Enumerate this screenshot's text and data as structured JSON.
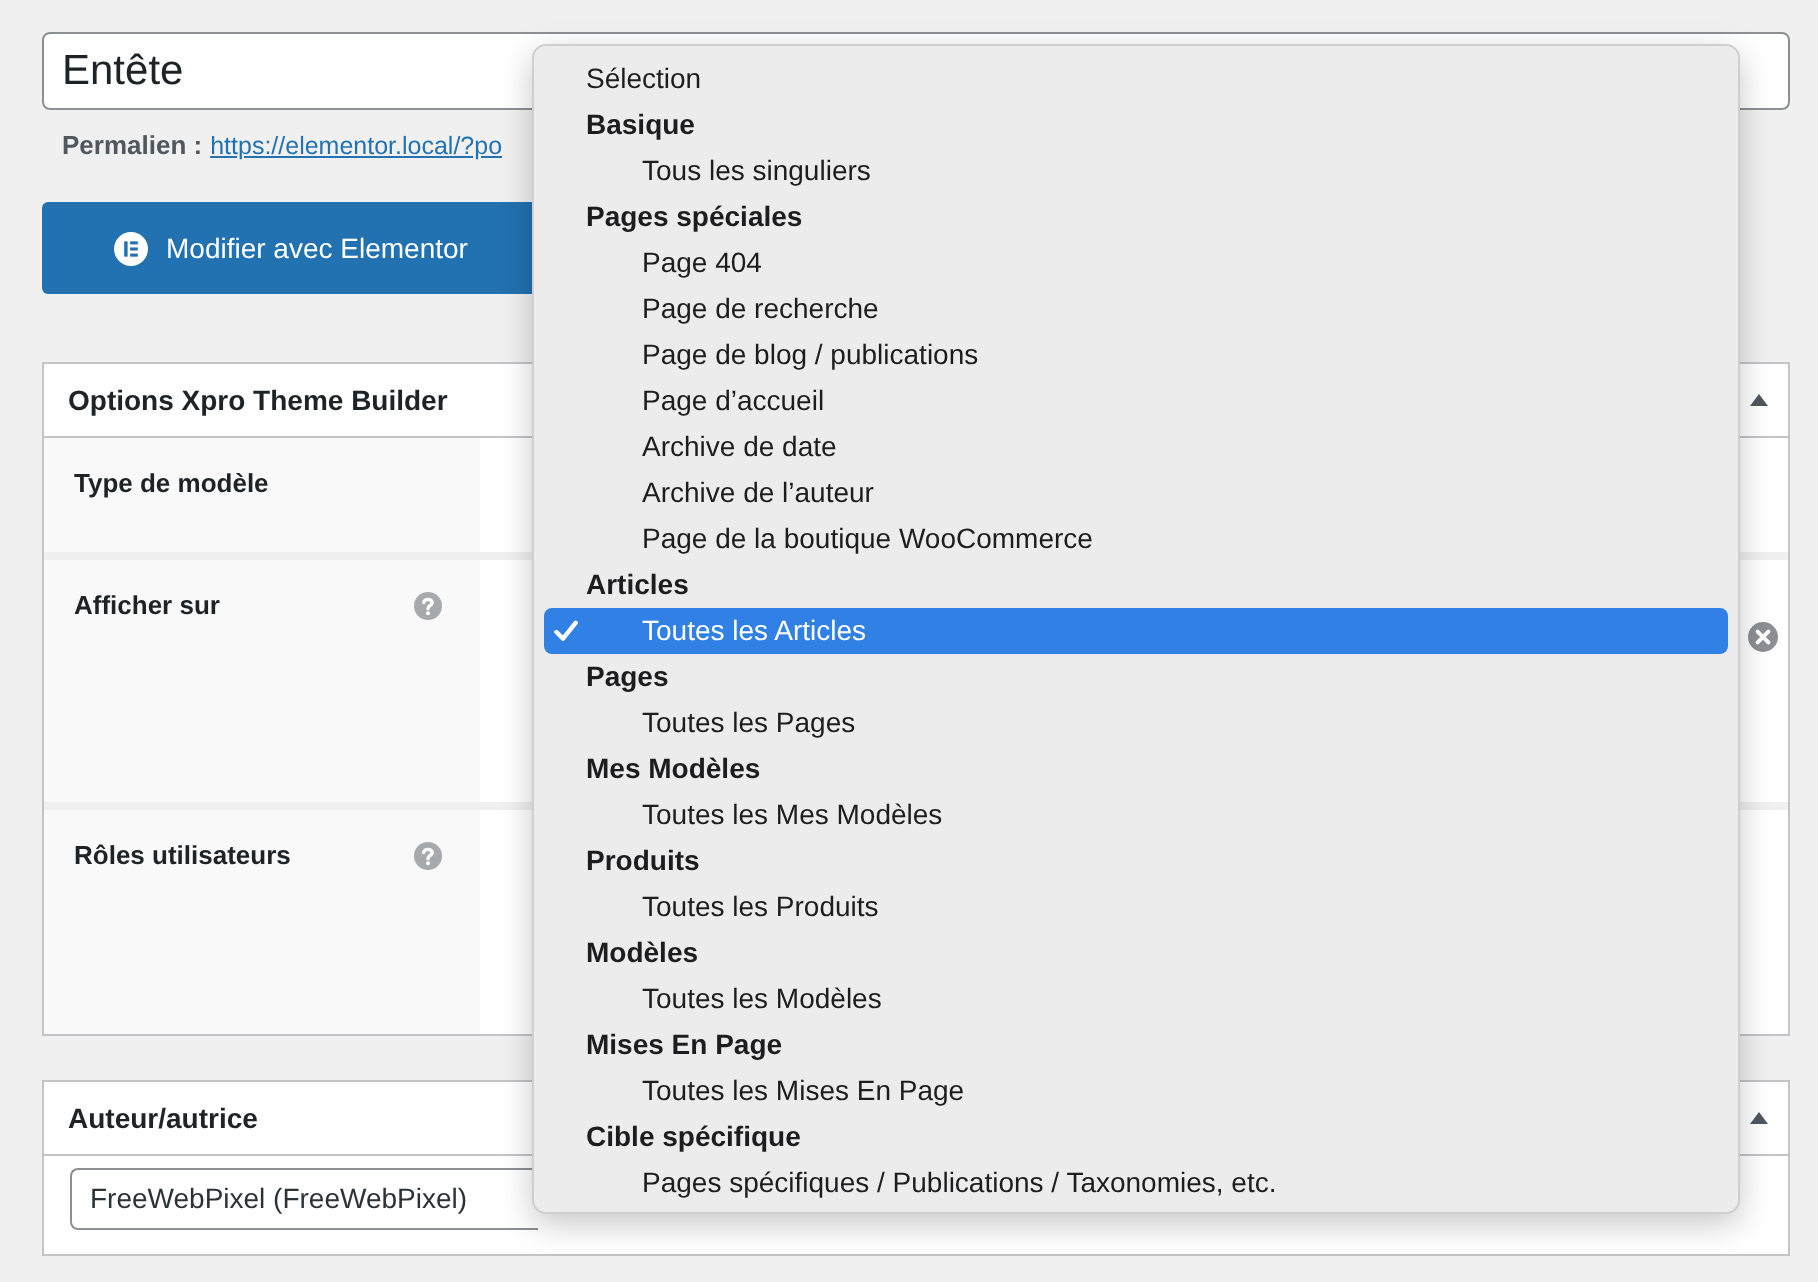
{
  "title_field": {
    "value": "Entête"
  },
  "permalink": {
    "label": "Permalien :",
    "url": "https://elementor.local/?po"
  },
  "edit_button": {
    "label": "Modifier avec Elementor"
  },
  "metaboxes": [
    {
      "kind": "fields",
      "title": "Options Xpro Theme Builder",
      "expanded": true,
      "rows": [
        {
          "label": "Type de modèle",
          "help": false,
          "clear_button": false
        },
        {
          "label": "Afficher sur",
          "help": true,
          "clear_button": true
        },
        {
          "label": "Rôles utilisateurs",
          "help": true,
          "clear_button": false
        }
      ]
    },
    {
      "kind": "select",
      "title": "Auteur/autrice",
      "expanded": true,
      "select": {
        "value": "FreeWebPixel (FreeWebPixel)"
      }
    }
  ],
  "dropdown": {
    "items": [
      {
        "kind": "option",
        "label": "Sélection",
        "selected": false
      },
      {
        "kind": "group",
        "label": "Basique",
        "children": [
          {
            "label": "Tous les singuliers",
            "selected": false
          }
        ]
      },
      {
        "kind": "group",
        "label": "Pages spéciales",
        "children": [
          {
            "label": "Page 404",
            "selected": false
          },
          {
            "label": "Page de recherche",
            "selected": false
          },
          {
            "label": "Page de blog / publications",
            "selected": false
          },
          {
            "label": "Page d’accueil",
            "selected": false
          },
          {
            "label": "Archive de date",
            "selected": false
          },
          {
            "label": "Archive de l’auteur",
            "selected": false
          },
          {
            "label": "Page de la boutique WooCommerce",
            "selected": false
          }
        ]
      },
      {
        "kind": "group",
        "label": "Articles",
        "children": [
          {
            "label": "Toutes les Articles",
            "selected": true
          }
        ]
      },
      {
        "kind": "group",
        "label": "Pages",
        "children": [
          {
            "label": "Toutes les Pages",
            "selected": false
          }
        ]
      },
      {
        "kind": "group",
        "label": "Mes Modèles",
        "children": [
          {
            "label": "Toutes les Mes Modèles",
            "selected": false
          }
        ]
      },
      {
        "kind": "group",
        "label": "Produits",
        "children": [
          {
            "label": "Toutes les Produits",
            "selected": false
          }
        ]
      },
      {
        "kind": "group",
        "label": "Modèles",
        "children": [
          {
            "label": "Toutes les Modèles",
            "selected": false
          }
        ]
      },
      {
        "kind": "group",
        "label": "Mises En Page",
        "children": [
          {
            "label": "Toutes les Mises En Page",
            "selected": false
          }
        ]
      },
      {
        "kind": "group",
        "label": "Cible spécifique",
        "children": [
          {
            "label": "Pages spécifiques / Publications / Taxonomies, etc.",
            "selected": false
          }
        ]
      }
    ]
  }
}
